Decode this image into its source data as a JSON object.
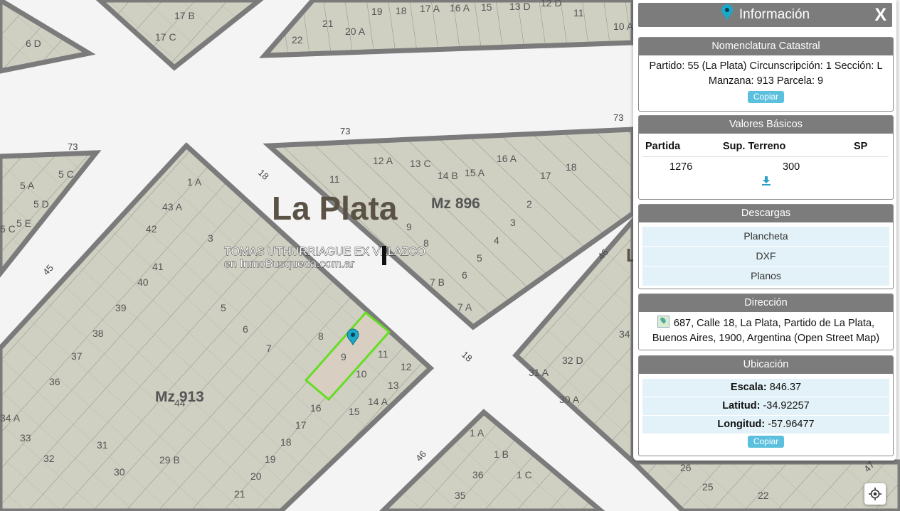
{
  "map": {
    "city_label": "La Plata",
    "watermark_line1": "TOMAS UTHURRIAGUE EX VELAZCO",
    "watermark_line2": "en InmoBusqueda.com.ar",
    "blocks": [
      "Mz 896",
      "Mz 913"
    ],
    "streets": [
      "73",
      "73",
      "73",
      "18",
      "18",
      "45",
      "46",
      "46",
      "47"
    ],
    "lots": [
      "6 D",
      "17 B",
      "17 C",
      "21",
      "22",
      "20 A",
      "19",
      "18",
      "17 A",
      "16 A",
      "15",
      "13 D",
      "12 D",
      "11",
      "10 A",
      "5 A",
      "5 C",
      "5 D",
      "5 E",
      "5 C",
      "1 A",
      "43 A",
      "42",
      "41",
      "40",
      "39",
      "38",
      "37",
      "36",
      "34 A",
      "33",
      "32",
      "31",
      "30",
      "29 B",
      "21",
      "20",
      "19",
      "18",
      "17",
      "16",
      "15",
      "14 A",
      "13",
      "12",
      "11",
      "10",
      "9",
      "8",
      "7",
      "6",
      "5",
      "3",
      "12 A",
      "13 C",
      "14 B",
      "15 A",
      "16 A",
      "17",
      "18",
      "11",
      "9",
      "8",
      "7 B",
      "7 A",
      "6",
      "5",
      "4",
      "3",
      "2",
      "31 A",
      "32 D",
      "30 A",
      "34",
      "1 A",
      "1 B",
      "1 C",
      "36",
      "35",
      "26",
      "25",
      "22",
      "44"
    ]
  },
  "panel": {
    "title": "Información",
    "close_label": "X",
    "nomenclatura": {
      "title": "Nomenclatura Catastral",
      "line1": "Partido: 55 (La Plata) Circunscripción: 1 Sección: L",
      "line2": "Manzana: 913 Parcela: 9",
      "copy_label": "Copiar"
    },
    "valores": {
      "title": "Valores Básicos",
      "headers": [
        "Partida",
        "Sup. Terreno",
        "SP"
      ],
      "row": [
        "1276",
        "300",
        ""
      ]
    },
    "descargas": {
      "title": "Descargas",
      "items": [
        "Plancheta",
        "DXF",
        "Planos"
      ]
    },
    "direccion": {
      "title": "Dirección",
      "line1": "687, Calle 18, La Plata, Partido de La Plata,",
      "line2": "Buenos Aires, 1900, Argentina (Open Street Map)"
    },
    "ubicacion": {
      "title": "Ubicación",
      "escala_label": "Escala:",
      "escala_value": "846.37",
      "latitud_label": "Latitud:",
      "latitud_value": "-34.92257",
      "longitud_label": "Longitud:",
      "longitud_value": "-57.96477",
      "copy_label": "Copiar"
    }
  },
  "colors": {
    "lot_fill": "#cfcfc2",
    "block_border": "#7b7b7b",
    "selected_outline": "#66dd22",
    "panel_header": "#7c7c7c",
    "accent": "#5bc0de",
    "pin": "#1aa9c9"
  }
}
